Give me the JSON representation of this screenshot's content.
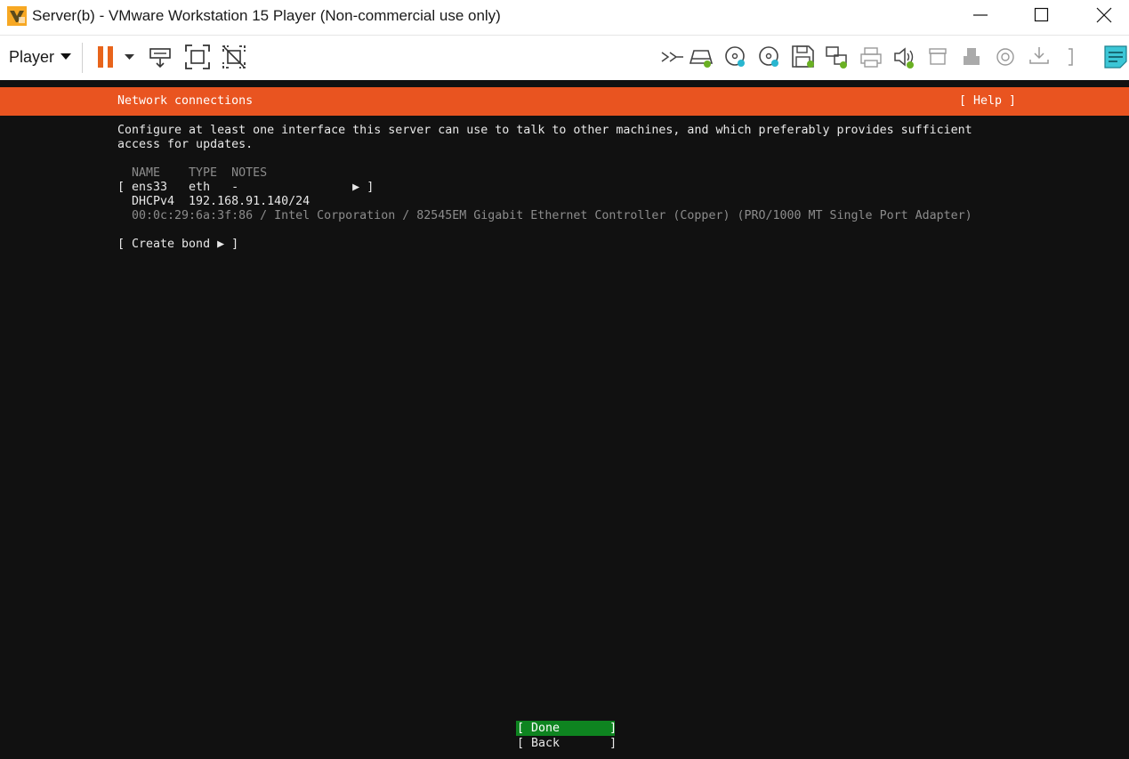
{
  "window": {
    "title": "Server(b) - VMware Workstation 15 Player (Non-commercial use only)",
    "logo_icon": "vmware-logo-icon",
    "controls": [
      "minimize-icon",
      "maximize-icon",
      "close-icon"
    ]
  },
  "toolbar": {
    "player_menu_label": "Player",
    "icons": [
      "pause-icon",
      "pause-dropdown-icon",
      "send-ctrl-alt-del-icon",
      "fullscreen-icon",
      "unity-icon",
      "message-log-icon",
      "hard-disk-icon",
      "cd-dvd-1-icon",
      "cd-dvd-2-icon",
      "floppy-icon",
      "network-adapter-icon",
      "printer-icon",
      "sound-card-icon",
      "archive-icon",
      "usb-device-icon",
      "camera-icon",
      "download-icon",
      "device-more-icon",
      "notes-icon"
    ],
    "accent_color": "#e8641b"
  },
  "installer": {
    "header_title": "Network connections",
    "help_label": "[ Help ]",
    "description_line1": "Configure at least one interface this server can use to talk to other machines, and which preferably provides sufficient",
    "description_line2": "access for updates.",
    "table_header": "NAME    TYPE  NOTES",
    "interface_row": "[ ens33   eth   -                ▶ ]",
    "dhcp_row": "DHCPv4  192.168.91.140/24",
    "hardware_row": "00:0c:29:6a:3f:86 / Intel Corporation / 82545EM Gigabit Ethernet Controller (Copper) (PRO/1000 MT Single Port Adapter)",
    "create_bond": "[ Create bond ▶ ]",
    "done_button": "[ Done       ]",
    "back_button": "[ Back       ]",
    "header_color": "#e95420",
    "done_color": "#0e8420"
  }
}
